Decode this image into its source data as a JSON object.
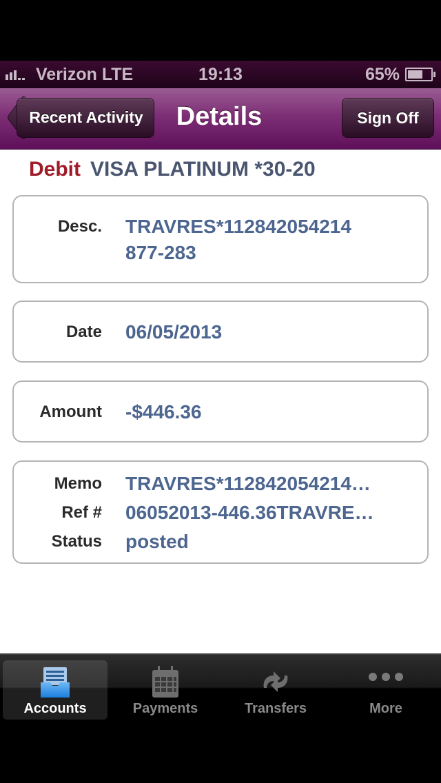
{
  "status_bar": {
    "carrier": "Verizon  LTE",
    "time": "19:13",
    "battery_percent": "65%",
    "battery_level": 0.65
  },
  "nav": {
    "back_label": "Recent Activity",
    "title": "Details",
    "sign_off_label": "Sign Off"
  },
  "transaction": {
    "type": "Debit",
    "account": "VISA PLATINUM *30-20",
    "colors": {
      "type": "#a01b2a",
      "account": "#4a5570",
      "value": "#4d6690"
    },
    "desc": {
      "label": "Desc.",
      "line1": "TRAVRES*112842054214",
      "line2": "877-283"
    },
    "date": {
      "label": "Date",
      "value": "06/05/2013"
    },
    "amount": {
      "label": "Amount",
      "value": "-$446.36"
    },
    "memo": {
      "label": "Memo",
      "value": "TRAVRES*112842054214…"
    },
    "ref": {
      "label": "Ref #",
      "value": "06052013-446.36TRAVRE…"
    },
    "status": {
      "label": "Status",
      "value": "posted"
    }
  },
  "tabbar": {
    "tabs": [
      {
        "label": "Accounts",
        "icon": "inbox-tray-icon",
        "active": true
      },
      {
        "label": "Payments",
        "icon": "calendar-icon",
        "active": false
      },
      {
        "label": "Transfers",
        "icon": "transfer-arrows-icon",
        "active": false
      },
      {
        "label": "More",
        "icon": "more-dots-icon",
        "active": false
      }
    ]
  }
}
